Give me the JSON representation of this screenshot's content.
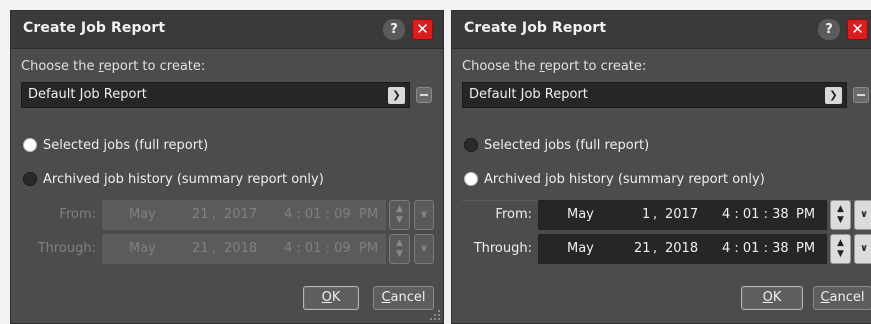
{
  "dialogs": [
    {
      "title": "Create Job Report",
      "help_label": "?",
      "close_label": "✕",
      "choose_label_prefix": "Choose the ",
      "choose_label_underline": "r",
      "choose_label_suffix": "eport to create:",
      "report_value": "Default Job Report",
      "option_selected": "Selected jobs (full report)",
      "option_archived": "Archived job history (summary report only)",
      "selected_option": "selected",
      "date_fields_enabled": false,
      "from_label": "From:",
      "through_label": "Through:",
      "from": {
        "month": "May",
        "day": "21",
        "year": "2017",
        "time": "4 : 01 : 09",
        "ampm": "PM"
      },
      "through": {
        "month": "May",
        "day": "21",
        "year": "2018",
        "time": "4 : 01 : 09",
        "ampm": "PM"
      },
      "ok_underline": "O",
      "ok_rest": "K",
      "cancel_underline": "C",
      "cancel_rest": "ancel"
    },
    {
      "title": "Create Job Report",
      "help_label": "?",
      "close_label": "✕",
      "choose_label_prefix": "Choose the ",
      "choose_label_underline": "r",
      "choose_label_suffix": "eport to create:",
      "report_value": "Default Job Report",
      "option_selected": "Selected jobs (full report)",
      "option_archived": "Archived job history (summary report only)",
      "selected_option": "archived",
      "date_fields_enabled": true,
      "from_label": "From:",
      "through_label": "Through:",
      "from": {
        "month": "May",
        "day": "1",
        "year": "2017",
        "time": "4 : 01 : 38",
        "ampm": "PM"
      },
      "through": {
        "month": "May",
        "day": "21",
        "year": "2018",
        "time": "4 : 01 : 38",
        "ampm": "PM"
      },
      "ok_underline": "O",
      "ok_rest": "K",
      "cancel_underline": "C",
      "cancel_rest": "ancel"
    }
  ],
  "icons": {
    "help": "help-icon",
    "close": "close-icon",
    "dropdown": "chevron-down-icon",
    "spin": "spin-updown-icon",
    "remove": "minus-icon",
    "resize": "resize-grip-icon"
  },
  "colors": {
    "dialog_bg": "#4c4c4c",
    "titlebar_bg": "#3a3a3a",
    "field_bg": "#262626",
    "close_red": "#d81e1e"
  },
  "punct": {
    "comma": ","
  }
}
